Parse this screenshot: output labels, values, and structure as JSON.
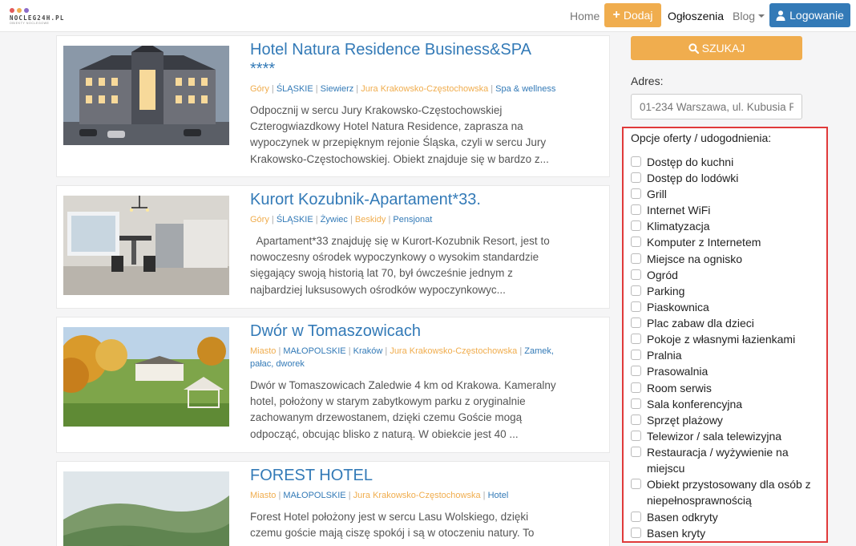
{
  "navbar": {
    "logo_text": "NOCLEG24H.PL",
    "logo_sub": "OBIEKTY NOCLEGOWE",
    "home": "Home",
    "add": "Dodaj",
    "listings": "Ogłoszenia",
    "blog": "Blog",
    "login": "Logowanie"
  },
  "listings": [
    {
      "title": "Hotel Natura Residence Business&SPA",
      "title2": "****",
      "meta": [
        {
          "t": "Góry",
          "c": "o"
        },
        {
          "t": "ŚLĄSKIE",
          "c": "b"
        },
        {
          "t": "Siewierz",
          "c": "b"
        },
        {
          "t": "Jura Krakowsko-Częstochowska",
          "c": "o"
        },
        {
          "t": "Spa & wellness",
          "c": "b"
        }
      ],
      "desc": "Odpocznij w sercu Jury Krakowsko-Częstochowskiej Czterogwiazdkowy Hotel Natura Residence, zaprasza na wypoczynek w przepięknym rejonie Śląska, czyli w sercu Jury Krakowsko-Częstochowskiej. Obiekt znajduje się w bardzo z..."
    },
    {
      "title": "Kurort Kozubnik-Apartament*33.",
      "meta": [
        {
          "t": "Góry",
          "c": "o"
        },
        {
          "t": "ŚLĄSKIE",
          "c": "b"
        },
        {
          "t": "Żywiec",
          "c": "b"
        },
        {
          "t": "Beskidy",
          "c": "o"
        },
        {
          "t": "Pensjonat",
          "c": "b"
        }
      ],
      "desc": "  Apartament*33 znajduję się w Kurort-Kozubnik Resort, jest to nowoczesny ośrodek wypoczynkowy o wysokim standardzie sięgający swoją historią lat 70, był ówcześnie jednym z najbardziej luksusowych ośrodków wypoczynkowyc..."
    },
    {
      "title": "Dwór w Tomaszowicach",
      "meta": [
        {
          "t": "Miasto",
          "c": "o"
        },
        {
          "t": "MAŁOPOLSKIE",
          "c": "b"
        },
        {
          "t": "Kraków",
          "c": "b"
        },
        {
          "t": "Jura Krakowsko-Częstochowska",
          "c": "o"
        },
        {
          "t": "Zamek, pałac, dworek",
          "c": "b"
        }
      ],
      "desc": "Dwór w Tomaszowicach Zaledwie 4 km od Krakowa. Kameralny hotel, położony w starym zabytkowym parku z oryginalnie zachowanym drzewostanem, dzięki czemu Goście mogą odpocząć, obcując blisko z naturą. W obiekcie jest 40 ..."
    },
    {
      "title": "FOREST HOTEL",
      "meta": [
        {
          "t": "Miasto",
          "c": "o"
        },
        {
          "t": "MAŁOPOLSKIE",
          "c": "b"
        },
        {
          "t": "Jura Krakowsko-Częstochowska",
          "c": "o"
        },
        {
          "t": "Hotel",
          "c": "b"
        }
      ],
      "desc": "Forest Hotel położony jest w sercu Lasu Wolskiego, dzięki czemu goście mają ciszę spokój i są w otoczeniu natury. To"
    }
  ],
  "sidebar": {
    "search": "SZUKAJ",
    "address_label": "Adres:",
    "address_placeholder": "01-234 Warszawa, ul. Kubusia P",
    "options_title": "Opcje oferty / udogodnienia:",
    "options": [
      "Dostęp do kuchni",
      "Dostęp do lodówki",
      "Grill",
      "Internet WiFi",
      "Klimatyzacja",
      "Komputer z Internetem",
      "Miejsce na ognisko",
      "Ogród",
      "Parking",
      "Piaskownica",
      "Plac zabaw dla dzieci",
      "Pokoje z własnymi łazienkami",
      "Pralnia",
      "Prasowalnia",
      "Room serwis",
      "Sala konferencyjna",
      "Sprzęt plażowy",
      "Telewizor / sala telewizyjna",
      "Restauracja / wyżywienie na miejscu",
      "Obiekt przystosowany dla osób z niepełnosprawnością",
      "Basen odkryty",
      "Basen kryty"
    ]
  },
  "colors": {
    "accent": "#f0ad4e",
    "primary": "#337ab7",
    "highlight": "#e03a3a"
  }
}
